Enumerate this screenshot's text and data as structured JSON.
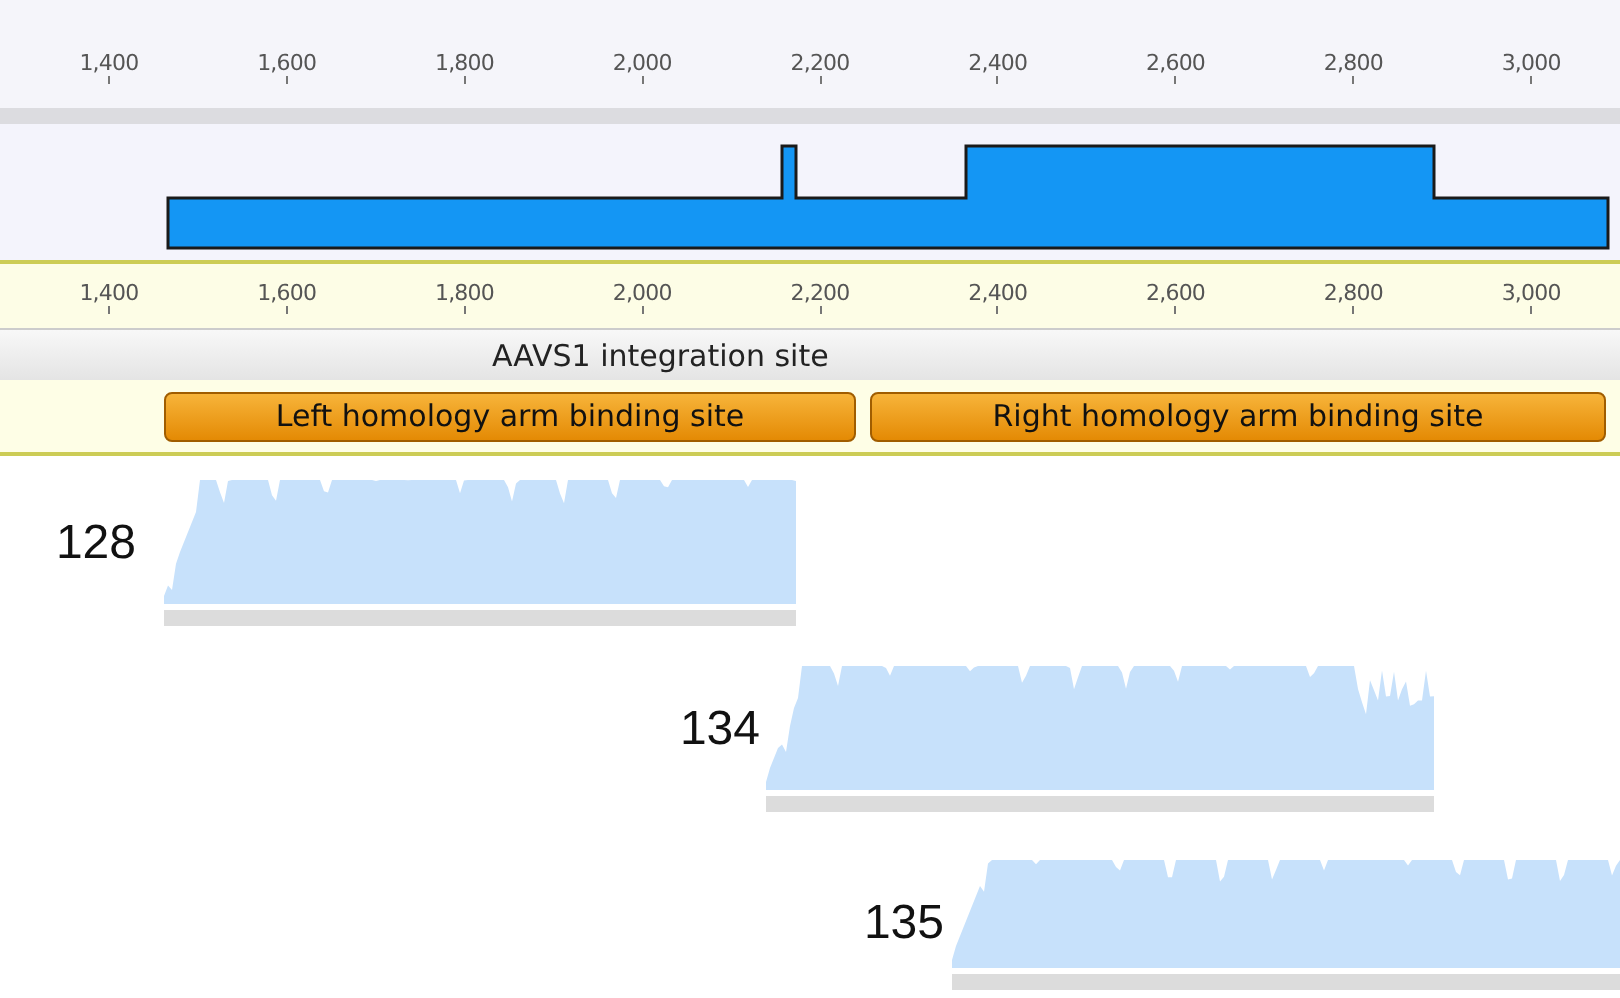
{
  "top_ruler": {
    "ticks": [
      "1,400",
      "1,600",
      "1,800",
      "2,000",
      "2,200",
      "2,400",
      "2,600",
      "2,800",
      "3,000"
    ]
  },
  "feature_ruler": {
    "ticks": [
      "1,400",
      "1,600",
      "1,800",
      "2,000",
      "2,200",
      "2,400",
      "2,600",
      "2,800",
      "3,000"
    ]
  },
  "track_label": "AAVS1 integration site",
  "features": [
    {
      "label": "Left homology arm binding site"
    },
    {
      "label": "Right homology arm binding site"
    }
  ],
  "reads": [
    {
      "label": "128"
    },
    {
      "label": "134"
    },
    {
      "label": "135"
    }
  ]
}
